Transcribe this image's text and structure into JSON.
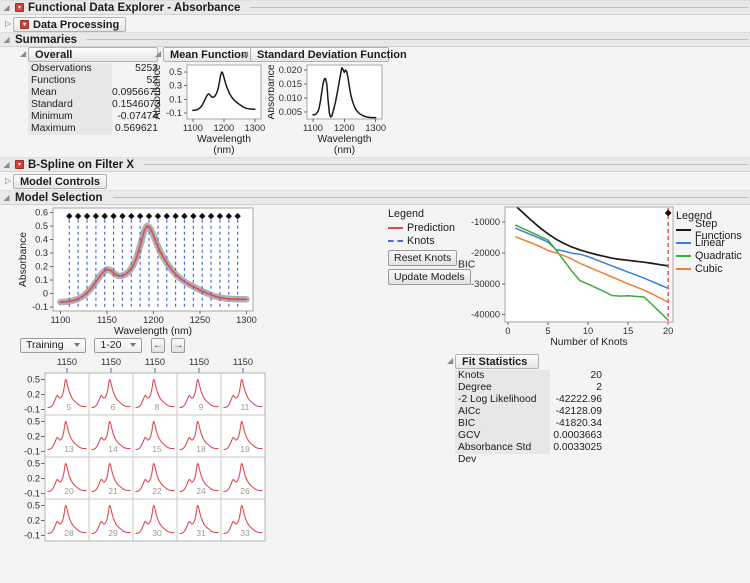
{
  "window_title": "Functional Data Explorer - Absorbance",
  "sections": {
    "data_processing": "Data Processing",
    "summaries": "Summaries",
    "bspline": "B-Spline on Filter X",
    "model_controls": "Model Controls",
    "model_selection": "Model Selection"
  },
  "overall": {
    "title": "Overall",
    "rows": [
      [
        "Observations",
        "5252"
      ],
      [
        "Functions",
        "52"
      ],
      [
        "Mean",
        "0.0956673"
      ],
      [
        "Standard Deviation",
        "0.1546073"
      ],
      [
        "Minimum",
        "-0.07474"
      ],
      [
        "Maximum",
        "0.569621"
      ]
    ]
  },
  "fit_statistics": {
    "title": "Fit Statistics",
    "rows": [
      [
        "Knots",
        "20"
      ],
      [
        "Degree",
        "2"
      ],
      [
        "-2 Log Likelihood",
        "-42222.96"
      ],
      [
        "AICc",
        "-42128.09"
      ],
      [
        "BIC",
        "-41820.34"
      ],
      [
        "GCV",
        "0.0003663"
      ],
      [
        "Absorbance Std Dev",
        "0.0033025"
      ]
    ]
  },
  "legend_left": {
    "title": "Legend",
    "items": [
      {
        "label": "Prediction",
        "color": "#dc4a52",
        "dash": "solid"
      },
      {
        "label": "Knots",
        "color": "#4a6fd4",
        "dash": "dashed"
      }
    ]
  },
  "legend_right": {
    "title": "Legend",
    "items": [
      {
        "label": "Step Functions",
        "color": "#1a1a1a",
        "dash": "solid"
      },
      {
        "label": "Linear",
        "color": "#3b7dd8",
        "dash": "solid"
      },
      {
        "label": "Quadratic",
        "color": "#3aab3a",
        "dash": "solid"
      },
      {
        "label": "Cubic",
        "color": "#ee7f33",
        "dash": "solid"
      }
    ]
  },
  "buttons": {
    "reset_knots": "Reset Knots",
    "update_models": "Update Models"
  },
  "selectors": {
    "training": "Training",
    "range": "1-20"
  },
  "grid": {
    "col_label": "1150",
    "ylabels": [
      "0.5",
      "0.2",
      "-0.1"
    ],
    "yvalues": [
      0.5,
      0.2,
      -0.1
    ],
    "cols": 5,
    "rows": 4,
    "cells": [
      "5",
      "6",
      "8",
      "9",
      "11",
      "13",
      "14",
      "15",
      "18",
      "19",
      "20",
      "21",
      "22",
      "24",
      "26",
      "28",
      "29",
      "30",
      "31",
      "33"
    ],
    "curve": "mean",
    "color": "#dc4a52",
    "xlim": [
      1095,
      1305
    ],
    "ylim": [
      -0.21,
      0.63
    ]
  },
  "curves": {
    "mean": {
      "x": [
        1100,
        1106,
        1112,
        1118,
        1124,
        1130,
        1134,
        1138,
        1142,
        1146,
        1150,
        1154,
        1158,
        1162,
        1166,
        1170,
        1174,
        1178,
        1182,
        1186,
        1190,
        1193,
        1196,
        1200,
        1204,
        1208,
        1212,
        1216,
        1220,
        1225,
        1230,
        1235,
        1240,
        1246,
        1252,
        1258,
        1264,
        1272,
        1280,
        1290,
        1300
      ],
      "y": [
        -0.062,
        -0.06,
        -0.054,
        -0.042,
        -0.02,
        0.015,
        0.048,
        0.085,
        0.125,
        0.16,
        0.18,
        0.172,
        0.148,
        0.132,
        0.13,
        0.143,
        0.168,
        0.205,
        0.268,
        0.36,
        0.462,
        0.5,
        0.488,
        0.43,
        0.36,
        0.3,
        0.252,
        0.21,
        0.172,
        0.135,
        0.105,
        0.082,
        0.062,
        0.04,
        0.02,
        0.002,
        -0.015,
        -0.03,
        -0.038,
        -0.042,
        -0.042
      ]
    },
    "std": {
      "x": [
        1100,
        1106,
        1112,
        1116,
        1120,
        1124,
        1128,
        1132,
        1136,
        1140,
        1144,
        1148,
        1152,
        1156,
        1160,
        1164,
        1168,
        1172,
        1176,
        1180,
        1184,
        1188,
        1192,
        1196,
        1200,
        1204,
        1208,
        1212,
        1216,
        1220,
        1225,
        1230,
        1236,
        1242,
        1250,
        1258,
        1266,
        1276,
        1288,
        1300
      ],
      "y": [
        0.004,
        0.004,
        0.0045,
        0.0052,
        0.0065,
        0.009,
        0.012,
        0.015,
        0.0168,
        0.017,
        0.015,
        0.0095,
        0.0048,
        0.0032,
        0.0035,
        0.005,
        0.0068,
        0.0088,
        0.011,
        0.0135,
        0.016,
        0.0185,
        0.0208,
        0.0202,
        0.0192,
        0.02,
        0.0193,
        0.017,
        0.014,
        0.0115,
        0.0092,
        0.0075,
        0.006,
        0.0051,
        0.0043,
        0.0038,
        0.0034,
        0.0031,
        0.003,
        0.003
      ]
    },
    "knots_x": [
      1109.5,
      1119.0,
      1128.6,
      1138.1,
      1147.6,
      1157.1,
      1166.7,
      1176.2,
      1185.7,
      1195.2,
      1204.8,
      1214.3,
      1223.8,
      1233.3,
      1242.9,
      1252.4,
      1261.9,
      1271.4,
      1281.0,
      1290.5
    ]
  },
  "charts": {
    "mean_function": {
      "title": "Mean Function",
      "xlim": [
        1081,
        1320
      ],
      "ylim": [
        -0.187,
        0.602
      ],
      "xticks": [
        1100,
        1200,
        1300
      ],
      "yticks": [
        0.5,
        0.3,
        0.1,
        -0.1
      ],
      "ylabel": "Absorbance",
      "xlabel": "Wavelength",
      "xlabel2": "(nm)",
      "series": [
        {
          "type": "line",
          "curve": "mean",
          "color": "#1a1a1a",
          "width": 1.5
        }
      ]
    },
    "std_function": {
      "title": "Standard Deviation Function",
      "xlim": [
        1081,
        1320
      ],
      "ylim": [
        0.0025,
        0.0218
      ],
      "xticks": [
        1100,
        1200,
        1300
      ],
      "yticks": [
        0.02,
        0.015,
        0.01,
        0.005
      ],
      "ytick_labels": [
        "0.020",
        "0.015",
        "0.010",
        "0.005"
      ],
      "ylabel": "Absorbance",
      "xlabel": "Wavelength",
      "xlabel2": "(nm)",
      "series": [
        {
          "type": "line",
          "curve": "std",
          "color": "#1a1a1a",
          "width": 1.5
        }
      ]
    },
    "model_fit": {
      "xlim": [
        1092,
        1307
      ],
      "ylim": [
        -0.128,
        0.632
      ],
      "xticks": [
        1100,
        1150,
        1200,
        1250,
        1300
      ],
      "yticks": [
        0.6,
        0.5,
        0.4,
        0.3,
        0.2,
        0.1,
        0,
        -0.1
      ],
      "ylabel": "Absorbance",
      "xlabel": "Wavelength (nm)",
      "series": [
        {
          "type": "band",
          "curve": "mean",
          "color": "#a9a9a9",
          "width": 6.5,
          "opacity": 0.9
        },
        {
          "type": "vlines",
          "xs": "knots_x",
          "y1": 0.545,
          "y2": -0.115,
          "color": "#4a6fd4",
          "width": 1.2,
          "dash": "3 3"
        },
        {
          "type": "line",
          "curve": "mean",
          "color": "#dc4a52",
          "width": 1.6
        },
        {
          "type": "diamonds",
          "xs": "knots_x",
          "yv": 0.572,
          "color": "#111111",
          "r": 3.2
        }
      ]
    },
    "bic": {
      "xlim": [
        -0.35,
        20.6
      ],
      "ylim": [
        -42400,
        -5100
      ],
      "xticks": [
        0,
        5,
        10,
        15,
        20
      ],
      "yticks": [
        -10000,
        -20000,
        -30000,
        -40000
      ],
      "ylabel": "BIC",
      "ylabel_horizontal": true,
      "xlabel": "Number of Knots",
      "x": [
        1,
        2,
        3,
        4,
        5,
        6,
        7,
        8,
        9,
        10,
        11,
        12,
        13,
        14,
        15,
        16,
        17,
        18,
        19,
        20
      ],
      "series": [
        {
          "type": "line",
          "name": "Step Functions",
          "color": "#1a1a1a",
          "width": 1.7,
          "y": [
            -4800,
            -7200,
            -9600,
            -11800,
            -13800,
            -15500,
            -16900,
            -18100,
            -19000,
            -19800,
            -20500,
            -21100,
            -21700,
            -22100,
            -22400,
            -22700,
            -23000,
            -23400,
            -23800,
            -24200
          ]
        },
        {
          "type": "line",
          "name": "Linear",
          "color": "#3b7dd8",
          "width": 1.5,
          "y": [
            -12000,
            -13100,
            -14200,
            -15300,
            -16500,
            -18900,
            -19400,
            -20100,
            -20400,
            -21200,
            -22200,
            -23200,
            -24200,
            -25200,
            -26200,
            -27200,
            -28200,
            -29300,
            -30400,
            -31500
          ]
        },
        {
          "type": "line",
          "name": "Quadratic",
          "color": "#3aab3a",
          "width": 1.5,
          "y": [
            -11000,
            -12200,
            -13400,
            -14600,
            -15800,
            -19000,
            -22500,
            -26000,
            -29000,
            -30100,
            -31300,
            -32500,
            -33800,
            -34000,
            -33900,
            -34100,
            -34300,
            -36800,
            -39300,
            -41800
          ]
        },
        {
          "type": "line",
          "name": "Cubic",
          "color": "#ee7f33",
          "width": 1.5,
          "y": [
            -14800,
            -15800,
            -16800,
            -17900,
            -19200,
            -20000,
            -20900,
            -22000,
            -23400,
            -24500,
            -25600,
            -26700,
            -27800,
            -28900,
            -30000,
            -31000,
            -32100,
            -33300,
            -34600,
            -36000
          ]
        },
        {
          "type": "vline",
          "xv": 20,
          "color": "#ef5a63",
          "width": 1.6,
          "dash": "4 3",
          "marker": "diamond",
          "marker_color": "#111111"
        }
      ]
    }
  }
}
